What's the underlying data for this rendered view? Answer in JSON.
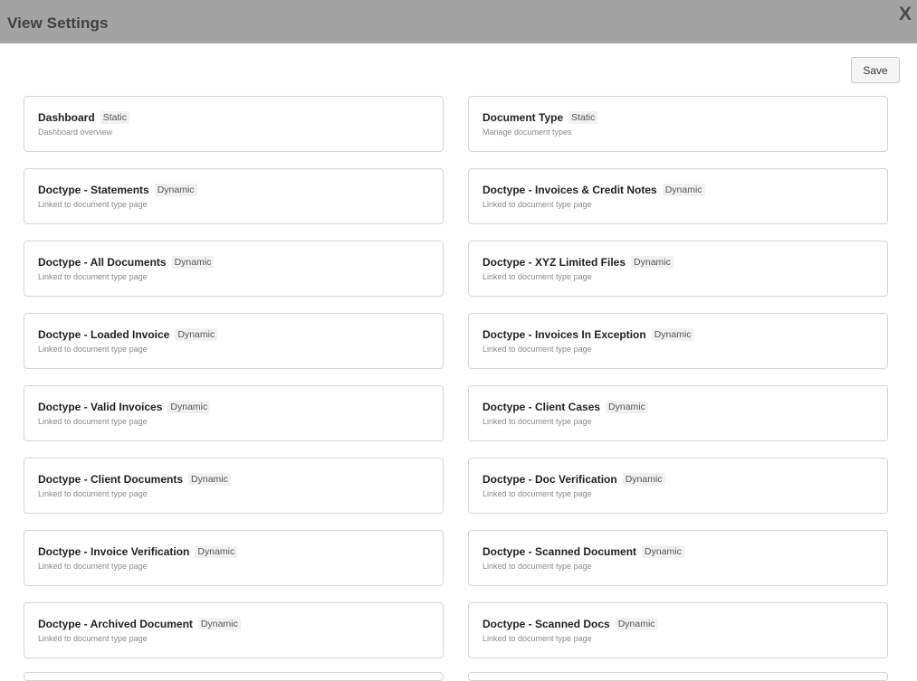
{
  "header": {
    "title": "View Settings",
    "close_label": "X"
  },
  "toolbar": {
    "save_label": "Save"
  },
  "cards": [
    {
      "title": "Dashboard",
      "badge": "Static",
      "description": "Dashboard overview"
    },
    {
      "title": "Document Type",
      "badge": "Static",
      "description": "Manage document types"
    },
    {
      "title": "Doctype - Statements",
      "badge": "Dynamic",
      "description": "Linked to document type page"
    },
    {
      "title": "Doctype - Invoices & Credit Notes",
      "badge": "Dynamic",
      "description": "Linked to document type page"
    },
    {
      "title": "Doctype - All Documents",
      "badge": "Dynamic",
      "description": "Linked to document type page"
    },
    {
      "title": "Doctype - XYZ Limited Files",
      "badge": "Dynamic",
      "description": "Linked to document type page"
    },
    {
      "title": "Doctype - Loaded Invoice",
      "badge": "Dynamic",
      "description": "Linked to document type page"
    },
    {
      "title": "Doctype - Invoices In Exception",
      "badge": "Dynamic",
      "description": "Linked to document type page"
    },
    {
      "title": "Doctype - Valid Invoices",
      "badge": "Dynamic",
      "description": "Linked to document type page"
    },
    {
      "title": "Doctype - Client Cases",
      "badge": "Dynamic",
      "description": "Linked to document type page"
    },
    {
      "title": "Doctype - Client Documents",
      "badge": "Dynamic",
      "description": "Linked to document type page"
    },
    {
      "title": "Doctype - Doc Verification",
      "badge": "Dynamic",
      "description": "Linked to document type page"
    },
    {
      "title": "Doctype - Invoice Verification",
      "badge": "Dynamic",
      "description": "Linked to document type page"
    },
    {
      "title": "Doctype - Scanned Document",
      "badge": "Dynamic",
      "description": "Linked to document type page"
    },
    {
      "title": "Doctype - Archived Document",
      "badge": "Dynamic",
      "description": "Linked to document type page"
    },
    {
      "title": "Doctype - Scanned Docs",
      "badge": "Dynamic",
      "description": "Linked to document type page"
    }
  ]
}
